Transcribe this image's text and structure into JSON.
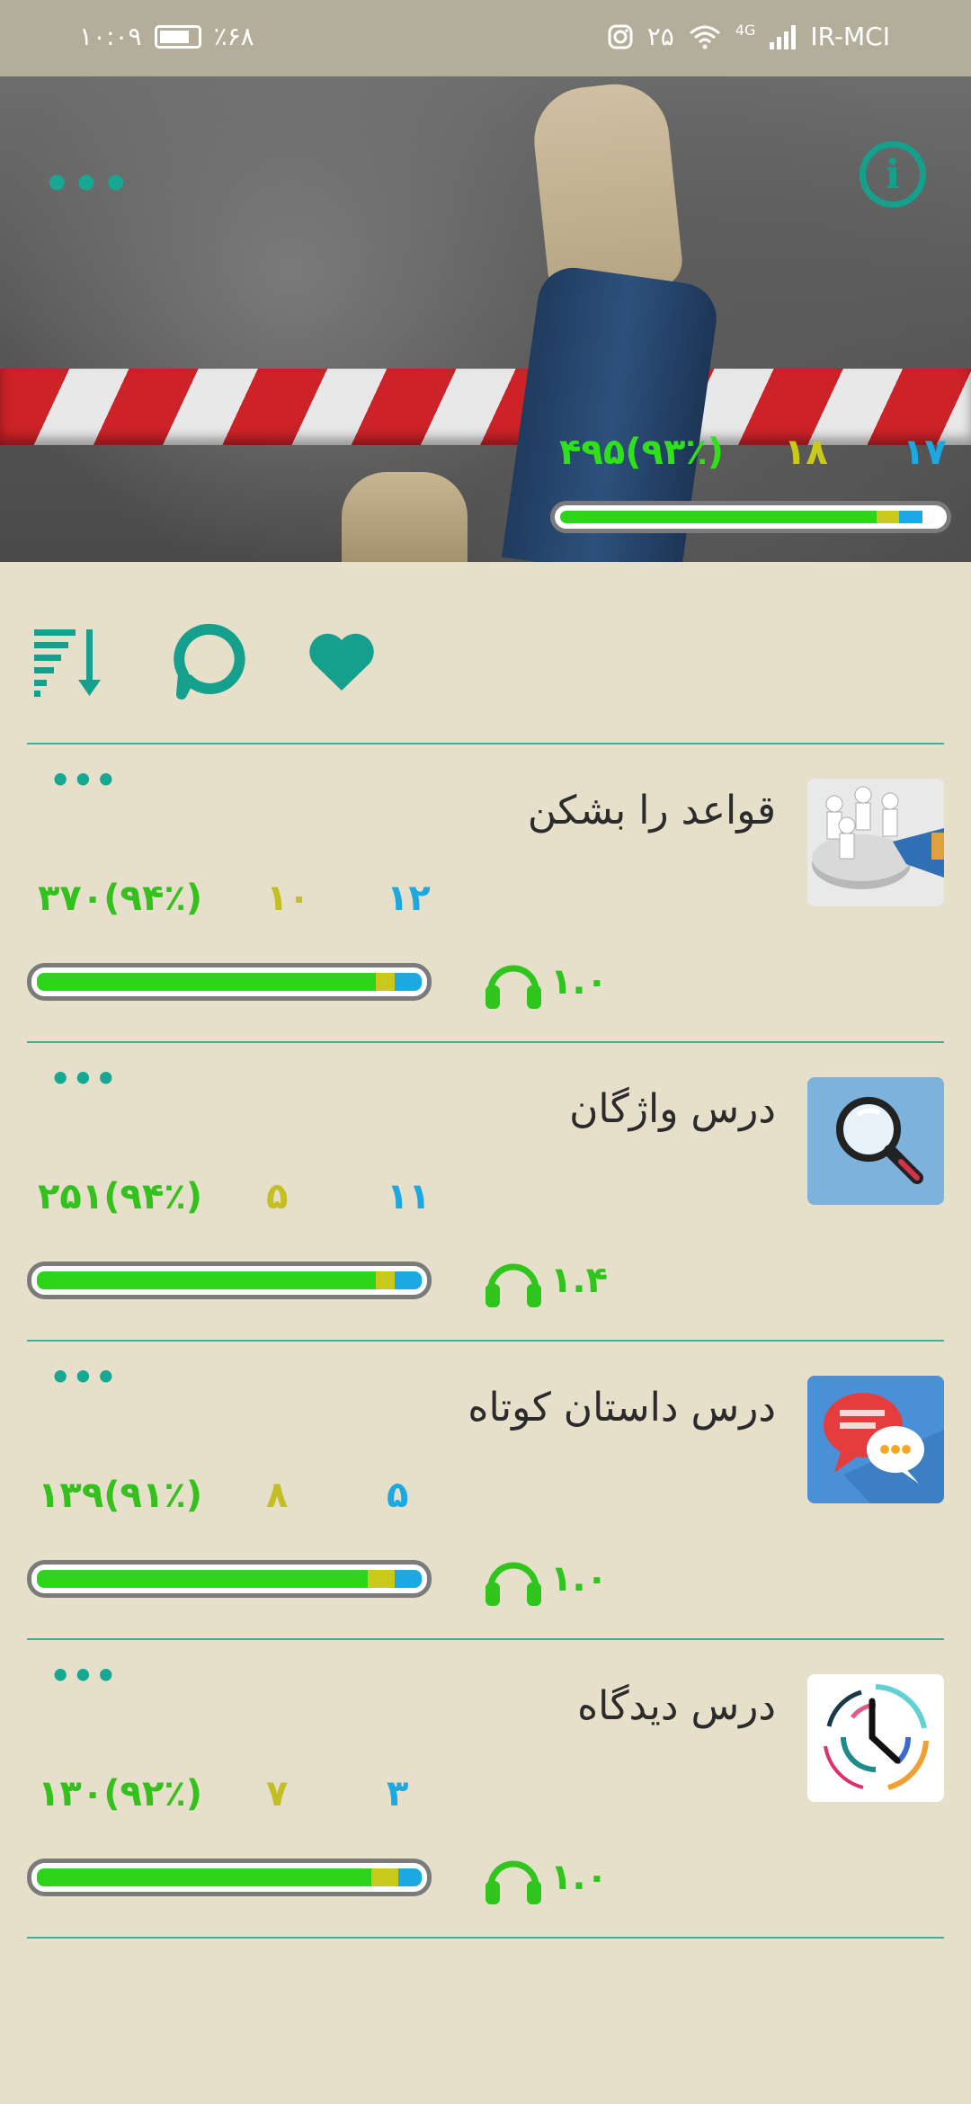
{
  "status_bar": {
    "time": "۱۰:۰۹",
    "battery": "٪۶۸",
    "notifications": "۲۵",
    "network_type": "4G",
    "carrier": "IR-MCI"
  },
  "header": {
    "stats": {
      "score": "۴۹۵(۹۳٪)",
      "mid": "۱۸",
      "new": "۱۷"
    },
    "progress": {
      "green": 0.83,
      "yellow": 0.06,
      "blue": 0.06
    }
  },
  "toolbar": {
    "icons": [
      "sort-icon",
      "chat-icon",
      "heart-icon"
    ]
  },
  "lessons": [
    {
      "title": "قواعد را بشکن",
      "score": "۳۷۰(۹۴٪)",
      "mid": "۱۰",
      "new": "۱۲",
      "speed": "۱.۰",
      "progress": {
        "green": 0.88,
        "yellow": 0.05,
        "blue": 0.07
      },
      "thumb": "business-people-thumb"
    },
    {
      "title": "درس واژگان",
      "score": "۲۵۱(۹۴٪)",
      "mid": "۵",
      "new": "۱۱",
      "speed": "۱.۴",
      "progress": {
        "green": 0.88,
        "yellow": 0.05,
        "blue": 0.07
      },
      "thumb": "magnifier-thumb"
    },
    {
      "title": "درس داستان کوتاه",
      "score": "۱۳۹(۹۱٪)",
      "mid": "۸",
      "new": "۵",
      "speed": "۱.۰",
      "progress": {
        "green": 0.86,
        "yellow": 0.07,
        "blue": 0.07
      },
      "thumb": "chat-bubbles-thumb"
    },
    {
      "title": "درس دیدگاه",
      "score": "۱۳۰(۹۲٪)",
      "mid": "۷",
      "new": "۳",
      "speed": "۱.۰",
      "progress": {
        "green": 0.87,
        "yellow": 0.07,
        "blue": 0.06
      },
      "thumb": "clock-thumb"
    }
  ],
  "colors": {
    "accent": "#14a08c",
    "background": "#e6dfca",
    "progress_green": "#2ed41b",
    "progress_yellow": "#c9c91b",
    "progress_blue": "#1ca8e0"
  }
}
